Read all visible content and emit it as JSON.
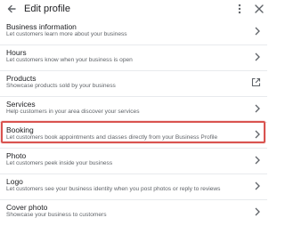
{
  "header": {
    "title": "Edit profile",
    "back_icon": "arrow-back-icon",
    "more_icon": "more-vert-icon",
    "close_icon": "close-icon"
  },
  "items": [
    {
      "label": "Business information",
      "desc": "Let customers learn more about your business",
      "icon": "chevron-right-icon"
    },
    {
      "label": "Hours",
      "desc": "Let customers know when your business is open",
      "icon": "chevron-right-icon"
    },
    {
      "label": "Products",
      "desc": "Showcase products sold by your business",
      "icon": "open-in-new-icon"
    },
    {
      "label": "Services",
      "desc": "Help customers in your area discover your services",
      "icon": "chevron-right-icon"
    },
    {
      "label": "Booking",
      "desc": "Let customers book appointments and classes directly from your Business Profile",
      "icon": "chevron-right-icon",
      "highlighted": true
    },
    {
      "label": "Photo",
      "desc": "Let customers peek inside your business",
      "icon": "chevron-right-icon"
    },
    {
      "label": "Logo",
      "desc": "Let customers see your business identity when you post photos or reply to reviews",
      "icon": "chevron-right-icon"
    },
    {
      "label": "Cover photo",
      "desc": "Showcase your business to customers",
      "icon": "chevron-right-icon"
    }
  ],
  "colors": {
    "highlight_border": "#d9534f",
    "text_primary": "#202124",
    "text_secondary": "#5f6368",
    "divider": "#e8eaed"
  }
}
